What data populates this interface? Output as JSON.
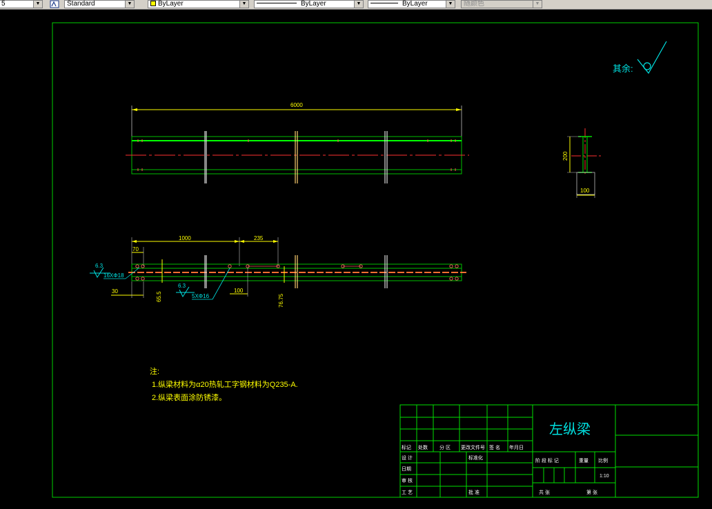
{
  "toolbar": {
    "partial_left": "5",
    "text_style": "Standard",
    "layer": "ByLayer",
    "linetype": "ByLayer",
    "lineweight": "ByLayer",
    "plot_color": "随颜色"
  },
  "drawing": {
    "roughness": "其余:",
    "top_length": "6000",
    "section_height": "200",
    "section_width": "100",
    "dim_1000": "1000",
    "dim_235": "235",
    "dim_70": "70",
    "dim_30": "30",
    "dim_100": "100",
    "dim_65_5": "65.5",
    "dim_76_75": "76.75",
    "rough_1": "6.3",
    "rough_2": "6.3",
    "holes_1": "16XΦ18",
    "holes_2": "5XΦ16",
    "notes": {
      "title": "注:",
      "line1": "1.纵梁材料为α20热轧工字钢材料为Q235-A.",
      "line2": "2.纵梁表面涂防锈漆。"
    }
  },
  "title_block": {
    "part_name": "左纵梁",
    "h_mark": "标记",
    "h_count": "处数",
    "h_zone": "分 区",
    "h_docno": "更改文件号",
    "h_sign": "签 名",
    "h_date": "年月日",
    "design": "设 计",
    "standard": "标准化",
    "date_lbl": "日期",
    "check": "审 核",
    "craft": "工 艺",
    "approve": "批 准",
    "stage": "阶 段 标 记",
    "weight": "重量",
    "ratio": "比例",
    "scale": "1:10",
    "total": "共  张",
    "sheet": "第  张"
  }
}
